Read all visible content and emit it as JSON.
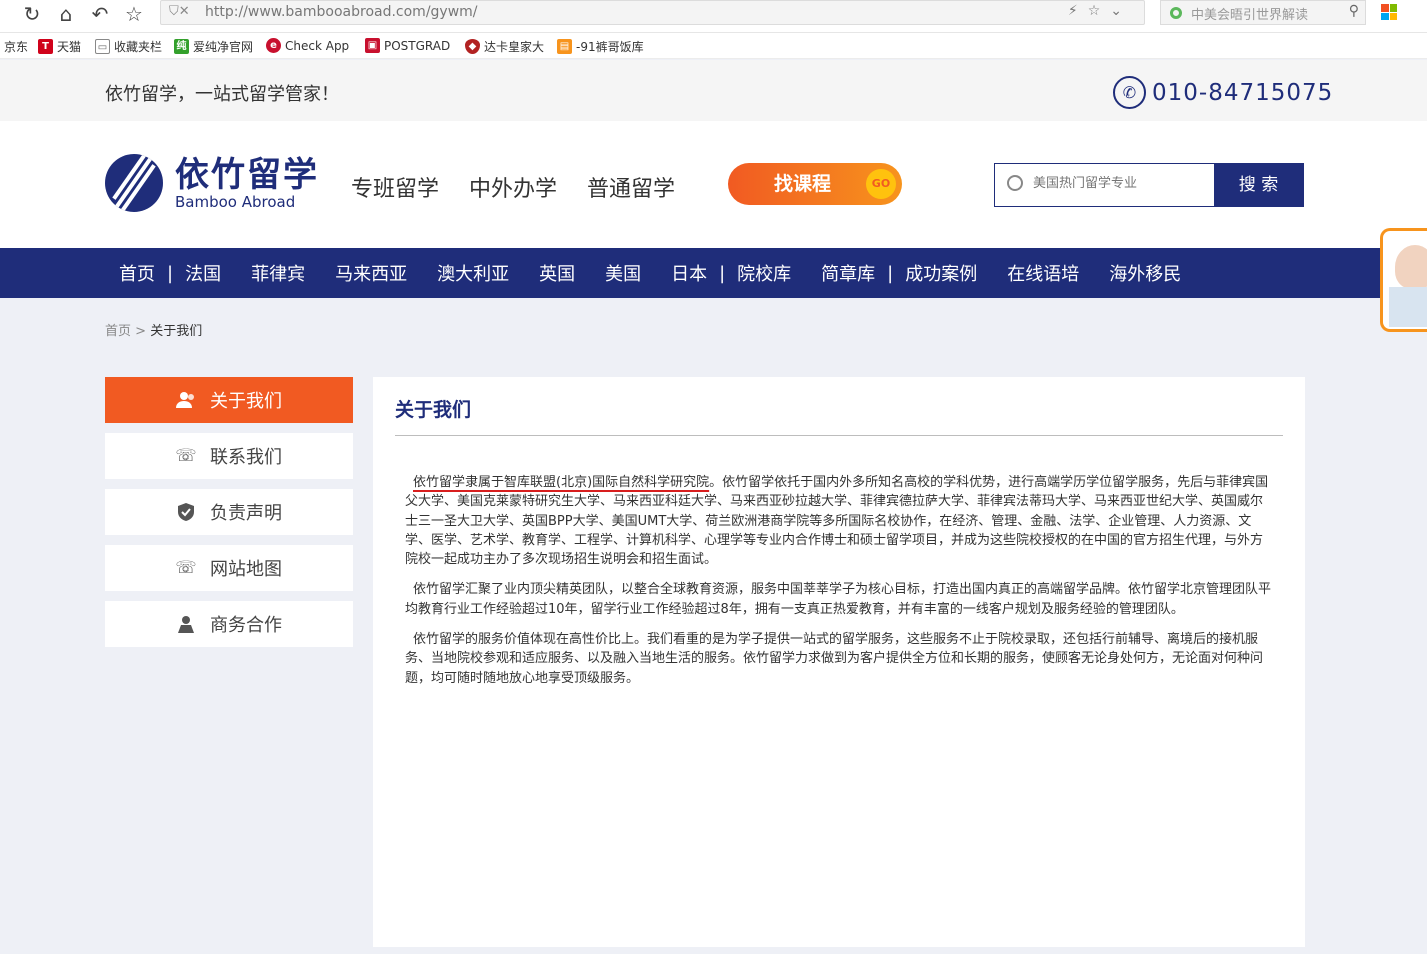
{
  "browser": {
    "url": "http://www.bambooabroad.com/gywm/",
    "search_placeholder": "中美会晤引世界解读",
    "bookmarks": [
      {
        "label": "京东",
        "icon": "jd-icon",
        "color": "#ffffff"
      },
      {
        "label": "天猫",
        "icon": "tmall-icon",
        "color": "#d0021b"
      },
      {
        "label": "收藏夹栏",
        "icon": "folder-icon",
        "color": "#888888"
      },
      {
        "label": "爱纯净官网",
        "icon": "aichunjing-icon",
        "color": "#33a02c"
      },
      {
        "label": "Check App",
        "icon": "checkapp-icon",
        "color": "#c8102e"
      },
      {
        "label": "POSTGRAD",
        "icon": "postgrad-icon",
        "color": "#c8102e"
      },
      {
        "label": "达卡皇家大",
        "icon": "shield-icon",
        "color": "#b22222"
      },
      {
        "label": "-91裤哥饭库",
        "icon": "bookmark-icon",
        "color": "#f7941d"
      }
    ]
  },
  "top_strip": {
    "slogan": "依竹留学，一站式留学管家！",
    "phone": "010-84715075"
  },
  "header": {
    "logo_cn": "依竹留学",
    "logo_en": "Bamboo Abroad",
    "nav": [
      "专班留学",
      "中外办学",
      "普通留学"
    ],
    "find_course_label": "找课程",
    "go_label": "GO",
    "search_placeholder": "美国热门留学专业",
    "search_button": "搜 索"
  },
  "blue_nav": {
    "items": [
      "首页",
      "|",
      "法国",
      "菲律宾",
      "马来西亚",
      "澳大利亚",
      "英国",
      "美国",
      "日本",
      "|",
      "院校库",
      "简章库",
      "|",
      "成功案例",
      "在线语培",
      "海外移民"
    ]
  },
  "breadcrumb": {
    "home": "首页",
    "separator": " > ",
    "current": "关于我们"
  },
  "sidebar": {
    "items": [
      {
        "label": "关于我们",
        "icon": "user-group-icon",
        "active": true
      },
      {
        "label": "联系我们",
        "icon": "phone-icon",
        "active": false
      },
      {
        "label": "负责声明",
        "icon": "shield-check-icon",
        "active": false
      },
      {
        "label": "网站地图",
        "icon": "phone-icon",
        "active": false
      },
      {
        "label": "商务合作",
        "icon": "location-person-icon",
        "active": false
      }
    ]
  },
  "content": {
    "title": "关于我们",
    "p1_highlight": "依竹留学隶属于智库联盟(北京)国际自然科学研究院",
    "p1_rest": "。依竹留学依托于国内外多所知名高校的学科优势，进行高端学历学位留学服务，先后与菲律宾国父大学、美国克莱蒙特研究生大学、马来西亚科廷大学、马来西亚砂拉越大学、菲律宾德拉萨大学、菲律宾法蒂玛大学、马来西亚世纪大学、英国威尔士三一圣大卫大学、英国BPP大学、美国UMT大学、荷兰欧洲港商学院等多所国际名校协作，在经济、管理、金融、法学、企业管理、人力资源、文学、医学、艺术学、教育学、工程学、计算机科学、心理学等专业内合作博士和硕士留学项目，并成为这些院校授权的在中国的官方招生代理，与外方院校一起成功主办了多次现场招生说明会和招生面试。",
    "p2": "依竹留学汇聚了业内顶尖精英团队，以整合全球教育资源，服务中国莘莘学子为核心目标，打造出国内真正的高端留学品牌。依竹留学北京管理团队平均教育行业工作经验超过10年，留学行业工作经验超过8年，拥有一支真正热爱教育，并有丰富的一线客户规划及服务经验的管理团队。",
    "p3": "依竹留学的服务价值体现在高性价比上。我们看重的是为学子提供一站式的留学服务，这些服务不止于院校录取，还包括行前辅导、离境后的接机服务、当地院校参观和适应服务、以及融入当地生活的服务。依竹留学力求做到为客户提供全方位和长期的服务，使顾客无论身处何方，无论面对何种问题，均可随时随地放心地享受顶级服务。"
  },
  "colors": {
    "brand_navy": "#1f2d7a",
    "accent_orange": "#f15a22",
    "page_bg": "#eef0f6"
  }
}
